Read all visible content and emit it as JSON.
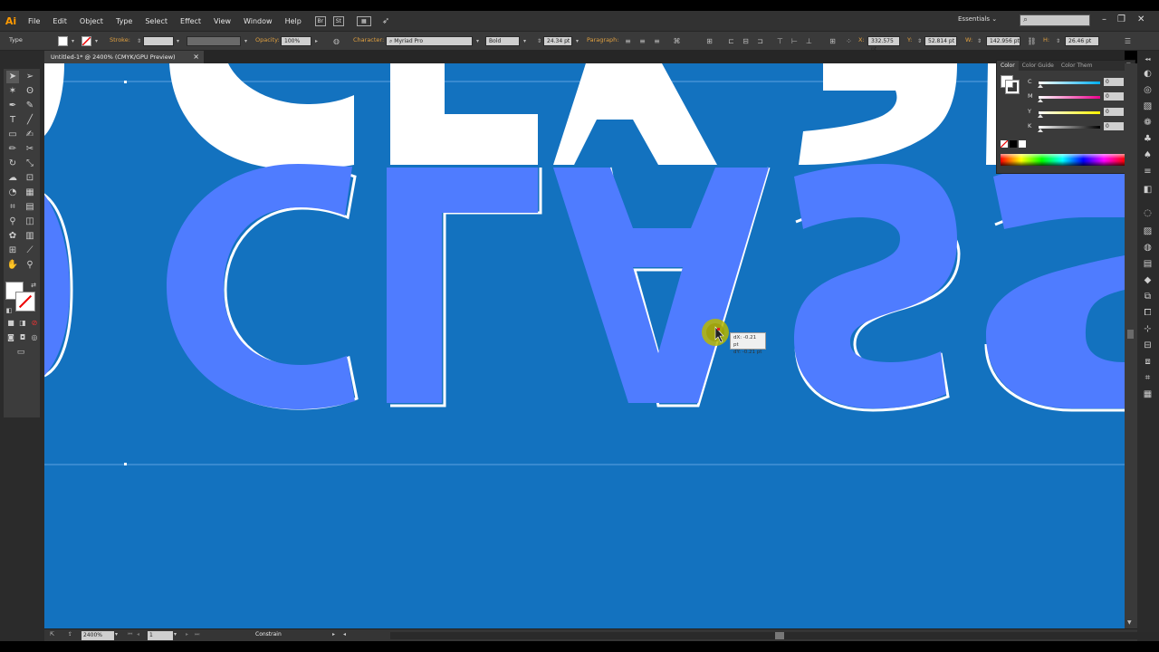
{
  "app": {
    "logo": "Ai"
  },
  "menubar": {
    "items": [
      "File",
      "Edit",
      "Object",
      "Type",
      "Select",
      "Effect",
      "View",
      "Window",
      "Help"
    ],
    "bridge": "Br",
    "stock": "St",
    "workspace": "Essentials",
    "search_icon": "search-icon"
  },
  "controlbar": {
    "tool_name": "Type",
    "stroke_label": "Stroke:",
    "opacity_label": "Opacity:",
    "opacity_value": "100%",
    "character_label": "Character:",
    "font_family": "Myriad Pro",
    "font_style": "Bold",
    "font_size": "24.34 pt",
    "paragraph_label": "Paragraph:",
    "x_label": "X:",
    "x_value": "332.575 pt",
    "y_label": "Y:",
    "y_value": "52.814 pt",
    "w_label": "W:",
    "w_value": "142.956 pt",
    "h_label": "H:",
    "h_value": "26.46 pt"
  },
  "document": {
    "tab_title": "Untitled-1* @ 2400% (CMYK/GPU Preview)"
  },
  "tooltip": {
    "dx": "dX: -0.21 pt",
    "dy": "dY: -0.21 pt"
  },
  "color_panel": {
    "tabs": [
      "Color",
      "Color Guide",
      "Color Them"
    ],
    "sliders": [
      {
        "label": "C",
        "value": "0",
        "unit": "%",
        "color": "#00aeef"
      },
      {
        "label": "M",
        "value": "0",
        "unit": "%",
        "color": "#ec008c"
      },
      {
        "label": "Y",
        "value": "0",
        "unit": "%",
        "color": "#fff200"
      },
      {
        "label": "K",
        "value": "0",
        "unit": "%",
        "color": "#9a9a9a"
      }
    ]
  },
  "statusbar": {
    "zoom": "2400%",
    "artboard": "1",
    "status": "Constrain"
  },
  "colors": {
    "canvas_bg": "#1372bf",
    "letter_blue": "#4f7cff",
    "letter_white": "#ffffff",
    "cursor_highlight": "#b7b800"
  }
}
